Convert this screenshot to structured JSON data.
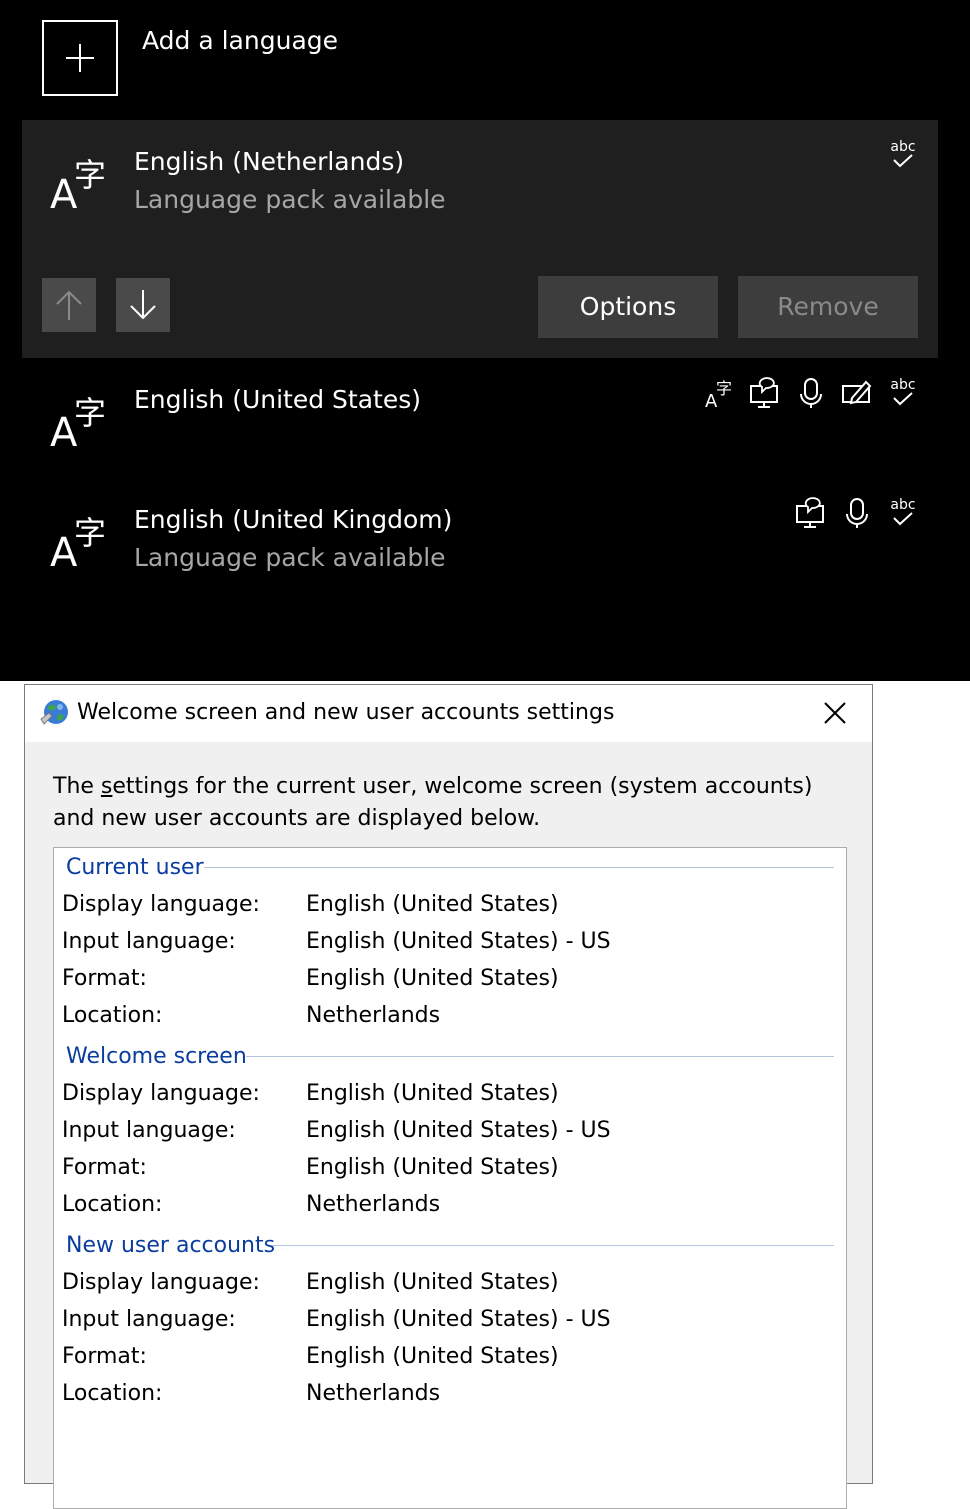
{
  "languages_panel": {
    "add_label": "Add a language",
    "languages": [
      {
        "name": "English (Netherlands)",
        "status": "Language pack available",
        "features": [
          "spelling-icon"
        ]
      },
      {
        "name": "English (United States)",
        "status": "",
        "features": [
          "language-pack-icon",
          "text-to-speech-icon",
          "speech-recognition-icon",
          "handwriting-icon",
          "spelling-icon"
        ]
      },
      {
        "name": "English (United Kingdom)",
        "status": "Language pack available",
        "features": [
          "text-to-speech-icon",
          "speech-recognition-icon",
          "spelling-icon"
        ]
      }
    ],
    "options_label": "Options",
    "remove_label": "Remove",
    "abc": "abc"
  },
  "dialog": {
    "title": "Welcome screen and new user accounts settings",
    "intro_pre": "The ",
    "intro_accel": "s",
    "intro_post": "ettings for the current user, welcome screen (system accounts) and new user accounts are displayed below.",
    "groups": [
      {
        "title": "Current user",
        "rows": [
          {
            "label": "Display language:",
            "value": "English (United States)"
          },
          {
            "label": "Input language:",
            "value": "English (United States) - US"
          },
          {
            "label": "Format:",
            "value": "English (United States)"
          },
          {
            "label": "Location:",
            "value": "Netherlands"
          }
        ]
      },
      {
        "title": "Welcome screen",
        "rows": [
          {
            "label": "Display language:",
            "value": "English (United States)"
          },
          {
            "label": "Input language:",
            "value": "English (United States) - US"
          },
          {
            "label": "Format:",
            "value": "English (United States)"
          },
          {
            "label": "Location:",
            "value": "Netherlands"
          }
        ]
      },
      {
        "title": "New user accounts",
        "rows": [
          {
            "label": "Display language:",
            "value": "English (United States)"
          },
          {
            "label": "Input language:",
            "value": "English (United States) - US"
          },
          {
            "label": "Format:",
            "value": "English (United States)"
          },
          {
            "label": "Location:",
            "value": "Netherlands"
          }
        ]
      }
    ]
  },
  "colors": {
    "dark_bg": "#000000",
    "selected_row": "#1f1f1f",
    "group_heading": "#0a3d9e",
    "dialog_bg": "#f0f0f0"
  }
}
